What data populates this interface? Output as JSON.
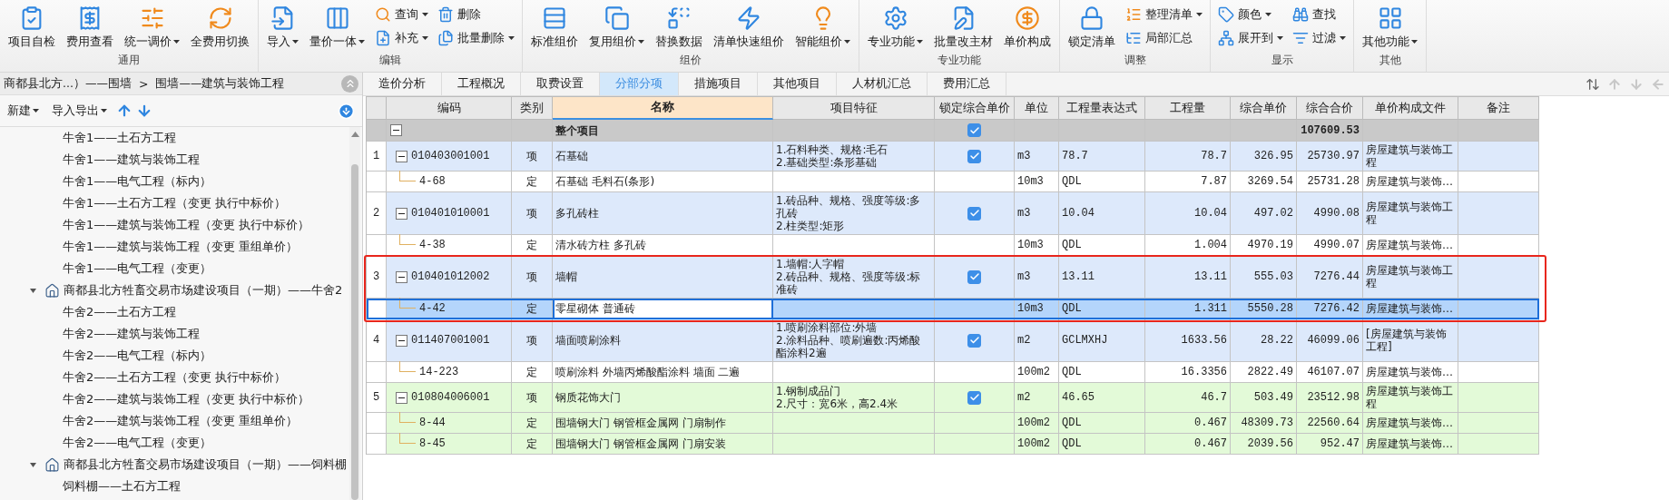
{
  "ribbon": {
    "groups": [
      {
        "label": "通用",
        "items": [
          {
            "kind": "large",
            "label": "项目自检",
            "menu": false
          },
          {
            "kind": "large",
            "label": "费用查看",
            "menu": false
          },
          {
            "kind": "large",
            "label": "统一调价",
            "menu": true
          },
          {
            "kind": "large",
            "label": "全费用切换",
            "menu": false
          }
        ]
      },
      {
        "label": "编辑",
        "items": [
          {
            "kind": "large",
            "label": "导入",
            "menu": true
          },
          {
            "kind": "large",
            "label": "量价一体",
            "menu": true
          },
          {
            "kind": "small",
            "label": "查询",
            "menu": true
          },
          {
            "kind": "small",
            "label": "补充",
            "menu": true
          },
          {
            "kind": "small",
            "label": "删除",
            "menu": false
          },
          {
            "kind": "small",
            "label": "批量删除",
            "menu": true
          }
        ]
      },
      {
        "label": "组价",
        "items": [
          {
            "kind": "large",
            "label": "标准组价",
            "menu": false
          },
          {
            "kind": "large",
            "label": "复用组价",
            "menu": true
          },
          {
            "kind": "large",
            "label": "替换数据",
            "menu": false
          },
          {
            "kind": "large",
            "label": "清单快速组价",
            "menu": false
          },
          {
            "kind": "large",
            "label": "智能组价",
            "menu": true
          }
        ]
      },
      {
        "label": "专业功能",
        "items": [
          {
            "kind": "large",
            "label": "专业功能",
            "menu": true
          },
          {
            "kind": "large",
            "label": "批量改主材",
            "menu": false
          },
          {
            "kind": "large",
            "label": "单价构成",
            "menu": false
          }
        ]
      },
      {
        "label": "调整",
        "items": [
          {
            "kind": "large",
            "label": "锁定清单",
            "menu": false
          },
          {
            "kind": "small",
            "label": "整理清单",
            "menu": true
          },
          {
            "kind": "small",
            "label": "局部汇总",
            "menu": false
          }
        ]
      },
      {
        "label": "显示",
        "items": [
          {
            "kind": "small",
            "label": "颜色",
            "menu": true
          },
          {
            "kind": "small",
            "label": "展开到",
            "menu": true
          },
          {
            "kind": "small",
            "label": "查找",
            "menu": false
          },
          {
            "kind": "small",
            "label": "过滤",
            "menu": true
          }
        ]
      },
      {
        "label": "其他",
        "items": [
          {
            "kind": "large",
            "label": "其他功能",
            "menu": true
          }
        ]
      }
    ]
  },
  "sidebar": {
    "breadcrumb": {
      "parts": [
        "商都县北方...）——围墙",
        "围墙——建筑与装饰工程"
      ],
      "separator": ">"
    },
    "toolbar": [
      {
        "label": "新建",
        "menu": true
      },
      {
        "label": "导入导出",
        "menu": true
      }
    ],
    "tree": {
      "continued_items": [
        "牛舍1——土石方工程",
        "牛舍1——建筑与装饰工程",
        "牛舍1——电气工程（标内）",
        "牛舍1——土石方工程（变更  执行中标价）",
        "牛舍1——建筑与装饰工程（变更  执行中标价）",
        "牛舍1——建筑与装饰工程（变更  重组单价）",
        "牛舍1——电气工程（变更）"
      ],
      "projects": [
        {
          "label": "商都县北方牲畜交易市场建设项目（一期）——牛舍2",
          "expanded": true,
          "children": [
            "牛舍2——土石方工程",
            "牛舍2——建筑与装饰工程",
            "牛舍2——电气工程（标内）",
            "牛舍2——土石方工程（变更  执行中标价）",
            "牛舍2——建筑与装饰工程（变更  执行中标价）",
            "牛舍2——建筑与装饰工程（变更  重组单价）",
            "牛舍2——电气工程（变更）"
          ]
        },
        {
          "label": "商都县北方牲畜交易市场建设项目（一期）——饲料棚",
          "expanded": true,
          "children": [
            "饲料棚——土石方工程"
          ]
        }
      ]
    }
  },
  "tabs": [
    {
      "label": "造价分析",
      "selected": false
    },
    {
      "label": "工程概况",
      "selected": false
    },
    {
      "label": "取费设置",
      "selected": false
    },
    {
      "label": "分部分项",
      "selected": true
    },
    {
      "label": "措施项目",
      "selected": false
    },
    {
      "label": "其他项目",
      "selected": false
    },
    {
      "label": "人材机汇总",
      "selected": false
    },
    {
      "label": "费用汇总",
      "selected": false
    }
  ],
  "table": {
    "columns": [
      {
        "label": "编码",
        "selected": false
      },
      {
        "label": "类别",
        "selected": false
      },
      {
        "label": "名称",
        "selected": true
      },
      {
        "label": "项目特征",
        "selected": false
      },
      {
        "label": "锁定综合单价",
        "selected": false
      },
      {
        "label": "单位",
        "selected": false
      },
      {
        "label": "工程量表达式",
        "selected": false
      },
      {
        "label": "工程量",
        "selected": false
      },
      {
        "label": "综合单价",
        "selected": false
      },
      {
        "label": "综合合价",
        "selected": false
      },
      {
        "label": "单价构成文件",
        "selected": false
      },
      {
        "label": "备注",
        "selected": false
      }
    ],
    "rows": [
      {
        "kind": "total",
        "name": "整个项目",
        "expanded": true,
        "locked": true,
        "total": "107609.53",
        "color": "#c9c9c9",
        "selected": false
      },
      {
        "kind": "item",
        "number": "1",
        "code": "010403001001",
        "expanded": true,
        "type": "项",
        "name": "石基础",
        "features": [
          "1.石料种类、规格:毛石",
          "2.基础类型:条形基础"
        ],
        "locked": true,
        "unit": "m3",
        "expr": "78.7",
        "qty": "78.7",
        "price": "326.95",
        "total": "25730.97",
        "file": "房屋建筑与装饰工程",
        "color": "#dde9fb",
        "selected": false
      },
      {
        "kind": "quota",
        "code": "4-68",
        "type": "定",
        "name": "石基础 毛料石(条形)",
        "unit": "10m3",
        "expr": "QDL",
        "qty": "7.87",
        "price": "3269.54",
        "total": "25731.28",
        "file": "房屋建筑与装饰…",
        "color": "#ffffff",
        "selected": false
      },
      {
        "kind": "item",
        "number": "2",
        "code": "010401010001",
        "expanded": true,
        "type": "项",
        "name": "多孔砖柱",
        "features": [
          "1.砖品种、规格、强度等级:多孔砖",
          "2.柱类型:矩形"
        ],
        "locked": true,
        "unit": "m3",
        "expr": "10.04",
        "qty": "10.04",
        "price": "497.02",
        "total": "4990.08",
        "file": "房屋建筑与装饰工程",
        "color": "#dde9fb",
        "selected": false
      },
      {
        "kind": "quota",
        "code": "4-38",
        "type": "定",
        "name": "清水砖方柱 多孔砖",
        "unit": "10m3",
        "expr": "QDL",
        "qty": "1.004",
        "price": "4970.19",
        "total": "4990.07",
        "file": "房屋建筑与装饰…",
        "color": "#ffffff",
        "selected": false
      },
      {
        "kind": "item",
        "number": "3",
        "code": "010401012002",
        "expanded": true,
        "type": "项",
        "name": "墙帽",
        "features": [
          "1.墙帽:人字帽",
          "2.砖品种、规格、强度等级:标准砖"
        ],
        "locked": true,
        "unit": "m3",
        "expr": "13.11",
        "qty": "13.11",
        "price": "555.03",
        "total": "7276.44",
        "file": "房屋建筑与装饰工程",
        "color": "#dde9fb",
        "selected": false
      },
      {
        "kind": "quota",
        "code": "4-42",
        "type": "定",
        "name": "零星砌体 普通砖",
        "unit": "10m3",
        "expr": "QDL",
        "qty": "1.311",
        "price": "5550.28",
        "total": "7276.42",
        "file": "房屋建筑与装饰…",
        "color": "#ffffff",
        "selected": true
      },
      {
        "kind": "item",
        "number": "4",
        "code": "011407001001",
        "expanded": true,
        "type": "项",
        "name": "墙面喷刷涂料",
        "features": [
          "1.喷刷涂料部位:外墙",
          "2.涂料品种、喷刷遍数:丙烯酸酯涂料2遍"
        ],
        "locked": true,
        "unit": "m2",
        "expr": "GCLMXHJ",
        "qty": "1633.56",
        "price": "28.22",
        "total": "46099.06",
        "file": "[房屋建筑与装饰工程]",
        "color": "#dde9fb",
        "selected": false
      },
      {
        "kind": "quota",
        "code": "14-223",
        "type": "定",
        "name": "喷刷涂料 外墙丙烯酸酯涂料 墙面 二遍",
        "unit": "100m2",
        "expr": "QDL",
        "qty": "16.3356",
        "price": "2822.49",
        "total": "46107.07",
        "file": "房屋建筑与装饰…",
        "color": "#ffffff",
        "selected": false
      },
      {
        "kind": "item",
        "number": "5",
        "code": "010804006001",
        "expanded": true,
        "type": "项",
        "name": "钢质花饰大门",
        "features": [
          "1.钢制成品门",
          "2.尺寸：宽6米，高2.4米"
        ],
        "locked": true,
        "unit": "m2",
        "expr": "46.65",
        "qty": "46.7",
        "price": "503.49",
        "total": "23512.98",
        "file": "房屋建筑与装饰工程",
        "color": "#e3fad8",
        "selected": false
      },
      {
        "kind": "quota",
        "code": "8-44",
        "type": "定",
        "name": "围墙钢大门 钢管框金属网 门扇制作",
        "unit": "100m2",
        "expr": "QDL",
        "qty": "0.467",
        "price": "48309.73",
        "total": "22560.64",
        "file": "房屋建筑与装饰…",
        "color": "#e3fad8",
        "selected": false
      },
      {
        "kind": "quota",
        "code": "8-45",
        "type": "定",
        "name": "围墙钢大门 钢管框金属网 门扇安装",
        "unit": "100m2",
        "expr": "QDL",
        "qty": "0.467",
        "price": "2039.56",
        "total": "952.47",
        "file": "房屋建筑与装饰…",
        "color": "#e3fad8",
        "selected": false
      }
    ]
  }
}
